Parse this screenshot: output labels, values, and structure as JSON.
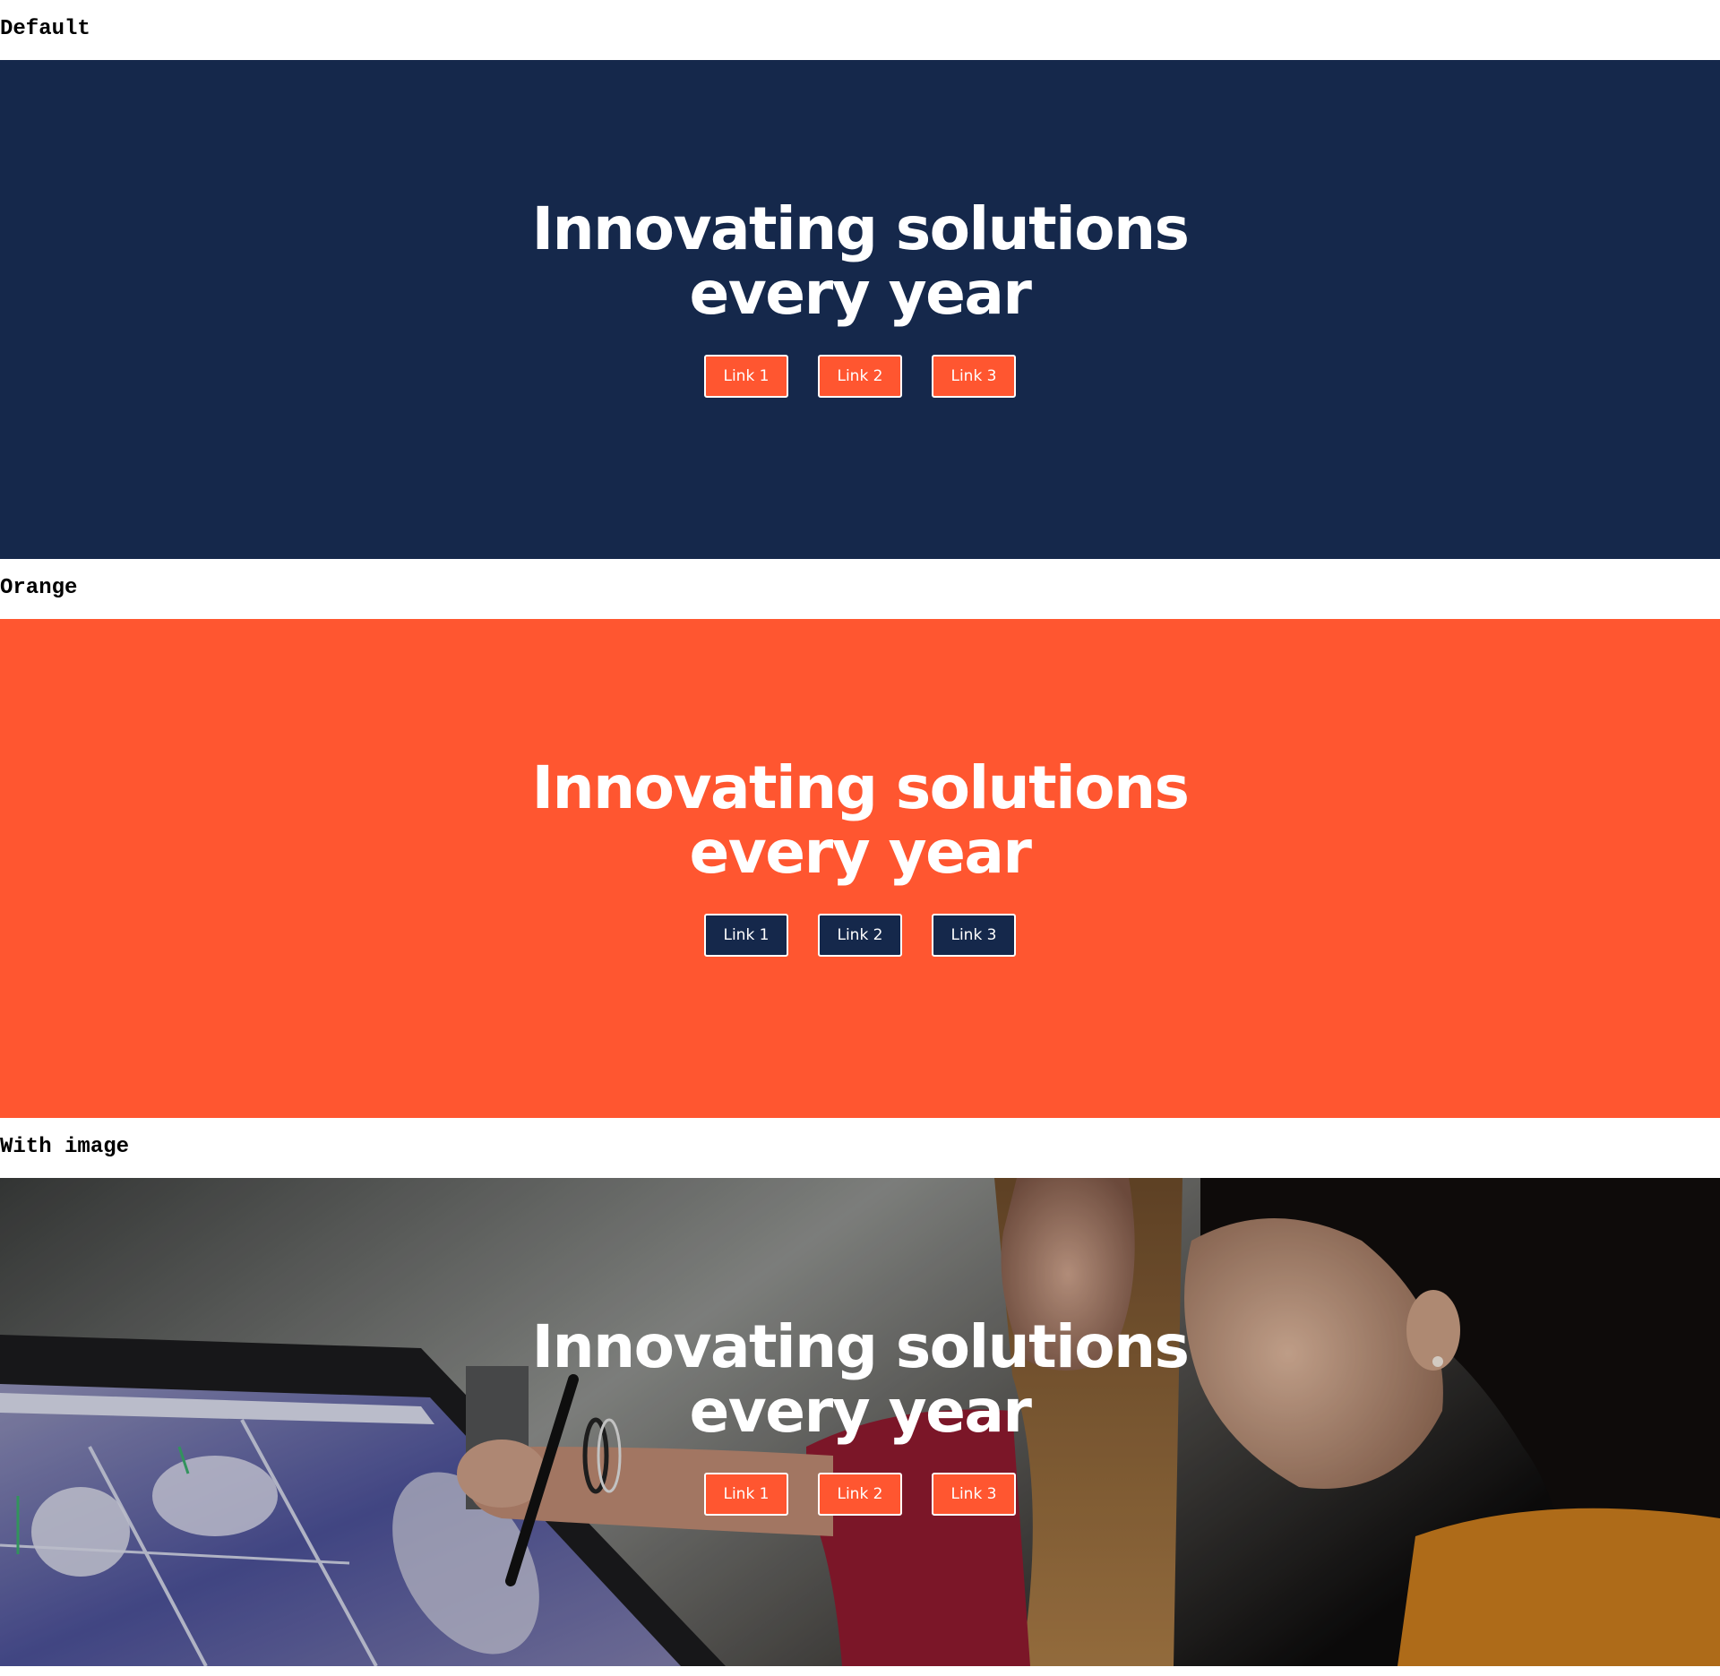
{
  "variants": [
    {
      "label": "Default",
      "title_line1": "Innovating solutions",
      "title_line2": "every year",
      "links": [
        "Link 1",
        "Link 2",
        "Link 3"
      ],
      "background": "#15284b",
      "link_color": "#ff5630"
    },
    {
      "label": "Orange",
      "title_line1": "Innovating solutions",
      "title_line2": "every year",
      "links": [
        "Link 1",
        "Link 2",
        "Link 3"
      ],
      "background": "#ff5630",
      "link_color": "#15284b"
    },
    {
      "label": "With image",
      "title_line1": "Innovating solutions",
      "title_line2": "every year",
      "links": [
        "Link 1",
        "Link 2",
        "Link 3"
      ],
      "background": "photo",
      "link_color": "#ff5630",
      "image_subject": "two-students-at-drawing-tablet"
    }
  ]
}
